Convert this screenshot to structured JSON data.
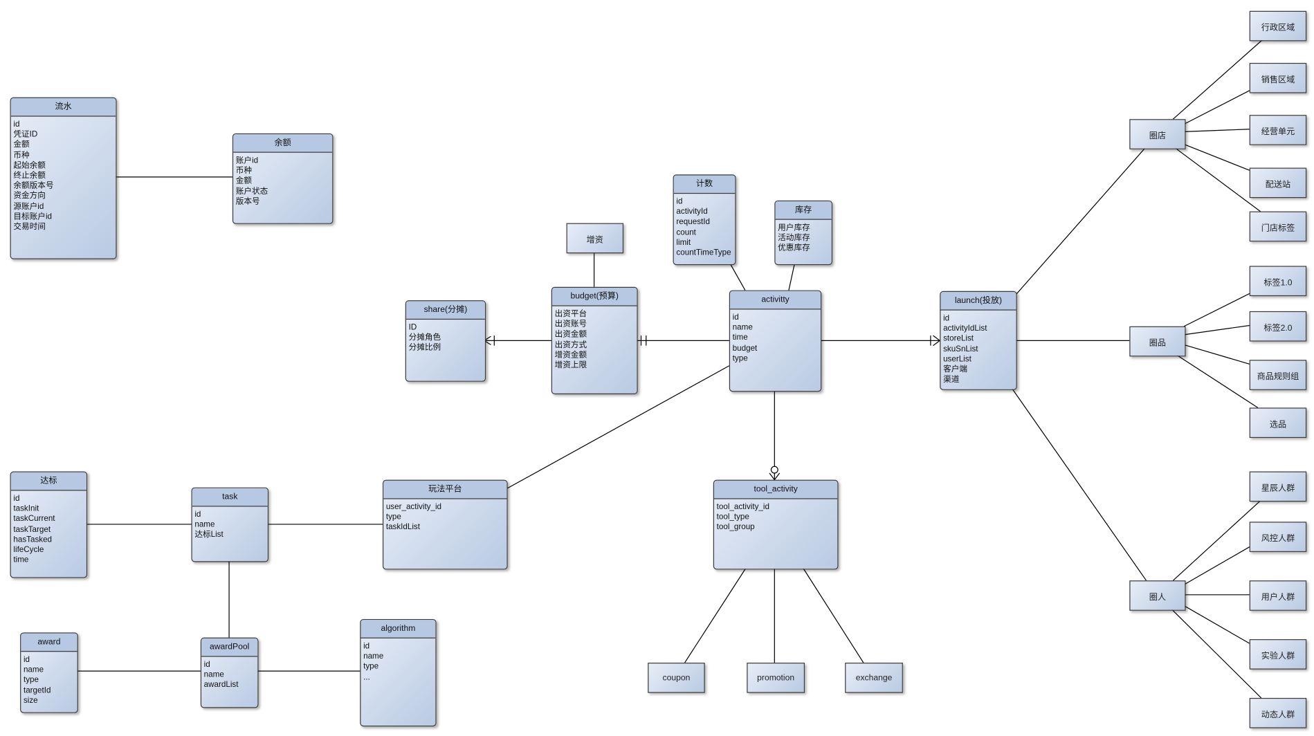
{
  "entities": {
    "liushui": {
      "title": "流水",
      "fields": [
        "id",
        "凭证ID",
        "金额",
        "币种",
        "起始余额",
        "终止余额",
        "余额版本号",
        "资金方向",
        "源账户id",
        "目标账户id",
        "交易时间"
      ]
    },
    "yue": {
      "title": "余额",
      "fields": [
        "账户id",
        "币种",
        "金额",
        "账户状态",
        "版本号"
      ]
    },
    "share": {
      "title": "share(分摊)",
      "fields": [
        "ID",
        "分摊角色",
        "分摊比例"
      ]
    },
    "budget": {
      "title": "budget(预算)",
      "fields": [
        "出资平台",
        "出资账号",
        "出资金额",
        "出资方式",
        "增资金额",
        "增资上限"
      ]
    },
    "jishu": {
      "title": "计数",
      "fields": [
        "id",
        "activityId",
        "requestId",
        "count",
        "limit",
        "countTimeType"
      ]
    },
    "kucun": {
      "title": "库存",
      "fields": [
        "用户库存",
        "活动库存",
        "优惠库存"
      ]
    },
    "activity": {
      "title": "activitty",
      "fields": [
        "id",
        "name",
        "time",
        "budget",
        "type"
      ]
    },
    "launch": {
      "title": "launch(投放)",
      "fields": [
        "id",
        "activityIdList",
        "storeList",
        "skuSnList",
        "userList",
        "客户端",
        "渠道"
      ]
    },
    "wanfa": {
      "title": "玩法平台",
      "fields": [
        "user_activity_id",
        "type",
        "taskIdList"
      ]
    },
    "tool_activity": {
      "title": "tool_activity",
      "fields": [
        "tool_activity_id",
        "tool_type",
        "tool_group"
      ]
    },
    "dabiao": {
      "title": "达标",
      "fields": [
        "id",
        "taskInit",
        "taskCurrent",
        "taskTarget",
        "hasTasked",
        "lifeCycle",
        "time"
      ]
    },
    "task": {
      "title": "task",
      "fields": [
        "id",
        "name",
        "达标List"
      ]
    },
    "award": {
      "title": "award",
      "fields": [
        "id",
        "name",
        "type",
        "targetId",
        "size"
      ]
    },
    "awardPool": {
      "title": "awardPool",
      "fields": [
        "id",
        "name",
        "awardList"
      ]
    },
    "algorithm": {
      "title": "algorithm",
      "fields": [
        "id",
        "name",
        "type",
        "..."
      ]
    }
  },
  "boxes": {
    "zengzi": "增资",
    "coupon": "coupon",
    "promotion": "promotion",
    "exchange": "exchange",
    "quandian": "圈店",
    "quanpin": "圈品",
    "quanren": "圈人",
    "xingzheng": "行政区域",
    "xiaoshou": "销售区域",
    "jingying": "经营单元",
    "peisong": "配送站",
    "mendian": "门店标签",
    "biaoqian1": "标签1.0",
    "biaoqian2": "标签2.0",
    "guize": "商品规则组",
    "xuanpin": "选品",
    "xingchen": "星辰人群",
    "fengkong": "风控人群",
    "yonghu": "用户人群",
    "shiyan": "实验人群",
    "dongtai": "动态人群"
  },
  "colors": {
    "entity_header": "#b7c9e2",
    "entity_body_light": "#e8eef7",
    "entity_body_dark": "#b9cae3",
    "line": "#000000"
  }
}
